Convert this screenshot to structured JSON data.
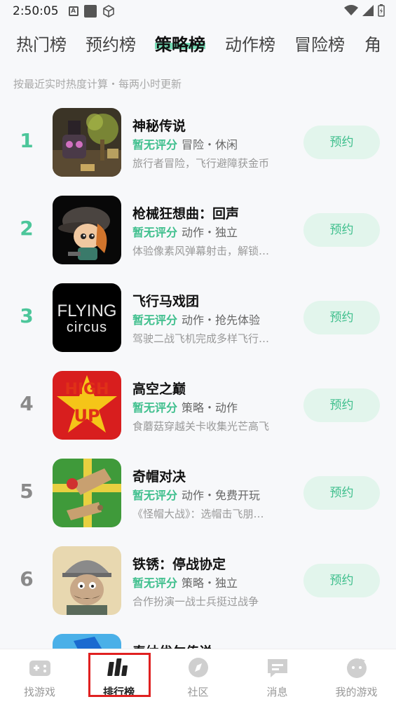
{
  "status_bar": {
    "time": "2:50:05"
  },
  "tabs": [
    {
      "label": "热门榜",
      "active": false
    },
    {
      "label": "预约榜",
      "active": false
    },
    {
      "label": "策略榜",
      "active": true
    },
    {
      "label": "动作榜",
      "active": false
    },
    {
      "label": "冒险榜",
      "active": false
    },
    {
      "label": "角",
      "active": false
    }
  ],
  "subtitle": "按最近实时热度计算・每两小时更新",
  "games": [
    {
      "rank": "1",
      "title": "神秘传说",
      "score": "暂无评分",
      "tags": "冒险・休闲",
      "desc": "旅行者冒险，飞行避障获金币",
      "button": "预约"
    },
    {
      "rank": "2",
      "title": "枪械狂想曲：回声",
      "score": "暂无评分",
      "tags": "动作・独立",
      "desc": "体验像素风弹幕射击，解锁…",
      "button": "预约"
    },
    {
      "rank": "3",
      "title": "飞行马戏团",
      "score": "暂无评分",
      "tags": "动作・抢先体验",
      "desc": "驾驶二战飞机完成多样飞行…",
      "button": "预约",
      "icon_text_1": "FLYING",
      "icon_text_2": "circus"
    },
    {
      "rank": "4",
      "title": "高空之巅",
      "score": "暂无评分",
      "tags": "策略・动作",
      "desc": "食蘑菇穿越关卡收集光芒高飞",
      "button": "预约",
      "icon_text_1": "HIGH",
      "icon_text_2": "UP"
    },
    {
      "rank": "5",
      "title": "奇帽对决",
      "score": "暂无评分",
      "tags": "动作・免费开玩",
      "desc": "《怪帽大战》：选帽击飞朋…",
      "button": "预约"
    },
    {
      "rank": "6",
      "title": "铁锈：停战协定",
      "score": "暂无评分",
      "tags": "策略・独立",
      "desc": "合作扮演一战士兵挺过战争",
      "button": "预约"
    },
    {
      "rank": "7",
      "title": "泰纳优尔传说",
      "score": "",
      "tags": "",
      "desc": "",
      "button": ""
    }
  ],
  "bottom_nav": [
    {
      "label": "找游戏",
      "icon": "gamepad-icon",
      "active": false
    },
    {
      "label": "排行榜",
      "icon": "ranking-icon",
      "active": true
    },
    {
      "label": "社区",
      "icon": "compass-icon",
      "active": false
    },
    {
      "label": "消息",
      "icon": "message-icon",
      "active": false
    },
    {
      "label": "我的游戏",
      "icon": "profile-icon",
      "active": false
    }
  ],
  "colors": {
    "accent": "#3fbf8d",
    "highlight": "#4cd6a0",
    "button_bg": "#e2f5ec",
    "annotation_box": "#e02020"
  }
}
